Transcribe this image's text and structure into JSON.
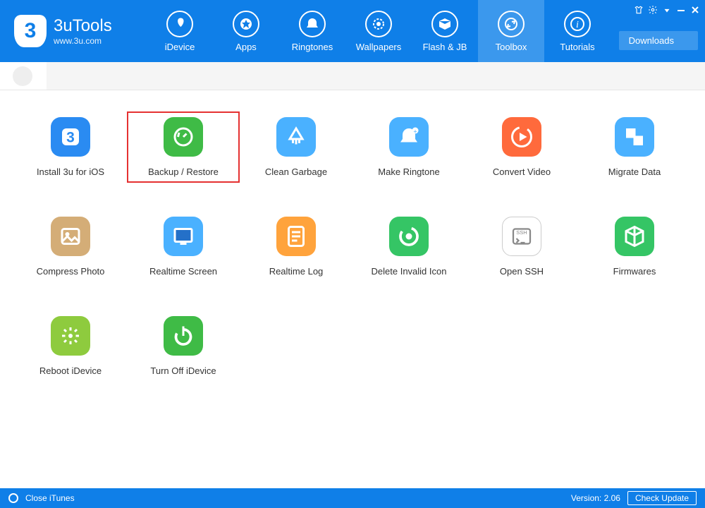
{
  "app": {
    "name": "3uTools",
    "site": "www.3u.com"
  },
  "nav": {
    "items": [
      {
        "label": "iDevice"
      },
      {
        "label": "Apps"
      },
      {
        "label": "Ringtones"
      },
      {
        "label": "Wallpapers"
      },
      {
        "label": "Flash & JB"
      },
      {
        "label": "Toolbox"
      },
      {
        "label": "Tutorials"
      }
    ],
    "active_index": 5
  },
  "downloads_label": "Downloads",
  "tools": [
    {
      "label": "Install 3u for iOS",
      "color": "#2a8bf2",
      "icon": "install3u"
    },
    {
      "label": "Backup / Restore",
      "color": "#3fbb46",
      "icon": "backup",
      "highlight": true
    },
    {
      "label": "Clean Garbage",
      "color": "#4ab1ff",
      "icon": "clean"
    },
    {
      "label": "Make Ringtone",
      "color": "#4ab1ff",
      "icon": "ringtone"
    },
    {
      "label": "Convert Video",
      "color": "#ff6a3c",
      "icon": "convert"
    },
    {
      "label": "Migrate Data",
      "color": "#4ab1ff",
      "icon": "migrate"
    },
    {
      "label": "Compress Photo",
      "color": "#d4ad77",
      "icon": "photo"
    },
    {
      "label": "Realtime Screen",
      "color": "#4ab1ff",
      "icon": "screen"
    },
    {
      "label": "Realtime Log",
      "color": "#ffa33c",
      "icon": "log"
    },
    {
      "label": "Delete Invalid Icon",
      "color": "#35c565",
      "icon": "delicon"
    },
    {
      "label": "Open SSH",
      "color": "#ffffff",
      "icon": "ssh",
      "border": true
    },
    {
      "label": "Firmwares",
      "color": "#35c565",
      "icon": "firmware"
    },
    {
      "label": "Reboot iDevice",
      "color": "#8ecb3e",
      "icon": "reboot"
    },
    {
      "label": "Turn Off iDevice",
      "color": "#3fbb46",
      "icon": "power"
    }
  ],
  "footer": {
    "close_itunes": "Close iTunes",
    "version_label": "Version: 2.06",
    "check_update": "Check Update"
  }
}
